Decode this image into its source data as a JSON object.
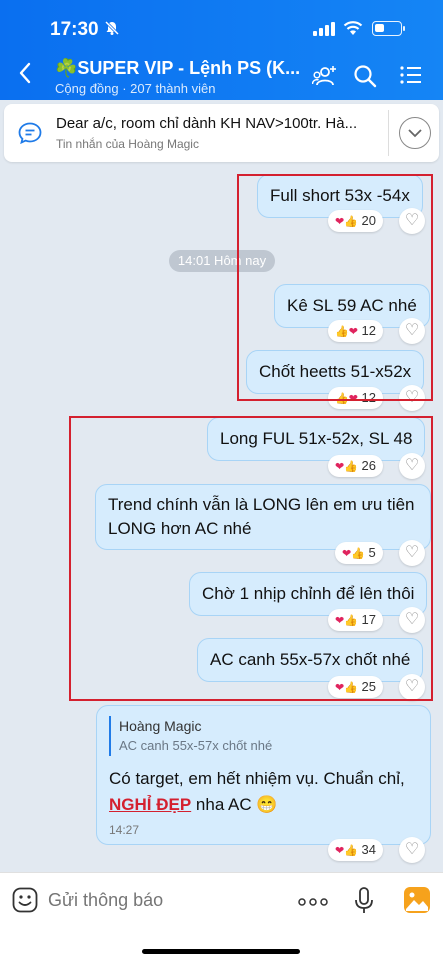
{
  "status_bar": {
    "time": "17:30",
    "battery_level": 0.3
  },
  "header": {
    "title": "☘️SUPER VIP - Lệnh PS (K...",
    "subtitle": "Cộng đồng · 207 thành viên",
    "accent": "#0a6ff0"
  },
  "pinned": {
    "text": "Dear a/c, room chỉ dành KH NAV>100tr. Hà...",
    "sub": "Tin nhắn của Hoàng Magic"
  },
  "time_separator": "14:01 Hôm nay",
  "messages": [
    {
      "text": "Full short 53x -54x",
      "reactions": "20"
    },
    {
      "text": "Kê SL 59 AC nhé",
      "reactions": "12"
    },
    {
      "text": "Chốt heetts 51-x52x",
      "reactions": "12"
    },
    {
      "text": "Long FUL 51x-52x, SL 48",
      "reactions": "26"
    },
    {
      "text": "Trend chính vẫn là LONG lên em ưu tiên LONG hơn AC nhé",
      "reactions": "5"
    },
    {
      "text": "Chờ 1 nhịp chỉnh để lên thôi",
      "reactions": "17"
    },
    {
      "text": "AC canh 55x-57x chốt nhé",
      "reactions": "25"
    }
  ],
  "reply": {
    "quote_name": "Hoàng Magic",
    "quote_text": "AC canh 55x-57x chốt nhé",
    "text_before": "Có target, em hết nhiệm vụ. Chuẩn chỉ,",
    "highlight": "NGHỈ ĐẸP",
    "text_after": " nha AC 😁",
    "time": "14:27",
    "reactions": "34"
  },
  "input": {
    "placeholder": "Gửi thông báo"
  },
  "highlight_color": "#d4202f"
}
